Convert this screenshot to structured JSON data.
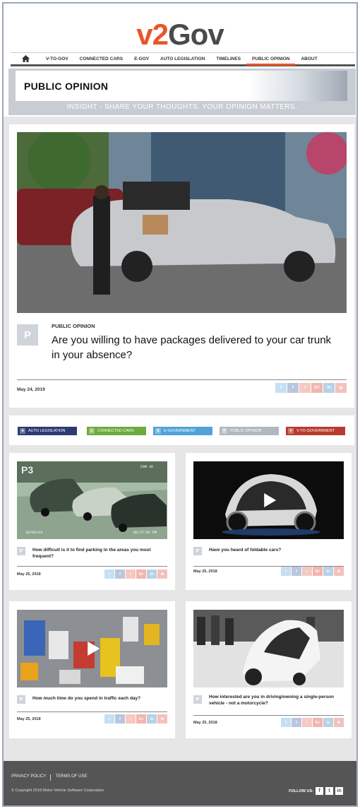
{
  "brand": {
    "logo_v2": "v2",
    "logo_gov": "Gov",
    "accent": "#e8562a"
  },
  "nav": {
    "home_icon": "home-icon",
    "items": [
      "V-TO-GOV",
      "CONNECTED CARS",
      "E-GOV",
      "AUTO LEGISLATION",
      "TIMELINES",
      "PUBLIC OPINION",
      "ABOUT"
    ],
    "active": "PUBLIC OPINION"
  },
  "banner": {
    "title": "PUBLIC OPINION",
    "subtitle": "INSIGHT - SHARE YOUR THOUGHTS. YOUR OPINION MATTERS."
  },
  "featured": {
    "category": "PUBLIC OPINION",
    "title": "Are you willing to have packages delivered to your car trunk in your absence?",
    "date": "May 24, 2019",
    "icon_letter": "P"
  },
  "share_icons": [
    "twitter-icon",
    "facebook-icon",
    "reddit-icon",
    "google-plus-icon",
    "linkedin-icon",
    "email-icon"
  ],
  "share_glyphs": [
    "t",
    "f",
    "r",
    "G+",
    "in",
    "✉"
  ],
  "categories": [
    {
      "letter": "A",
      "label": "AUTO LEGISLATION",
      "color": "#2c3b73"
    },
    {
      "letter": "C",
      "label": "CONNECTED CARS",
      "color": "#6dab3c"
    },
    {
      "letter": "E",
      "label": "E-GOVERNMENT",
      "color": "#4fa3d8"
    },
    {
      "letter": "P",
      "label": "PUBLIC OPINION",
      "color": "#b2b8c0"
    },
    {
      "letter": "V",
      "label": "V-TO-GOVERNMENT",
      "color": "#b73b2e"
    }
  ],
  "cards": [
    {
      "title": "How difficult is it to find parking in the areas you most frequent?",
      "date": "May 25, 2018",
      "icon_letter": "P"
    },
    {
      "title": "Have you heard of foldable cars?",
      "date": "May 25, 2018",
      "icon_letter": "P"
    },
    {
      "title": "How much time do you spend in traffic each day?",
      "date": "May 25, 2018",
      "icon_letter": "P"
    },
    {
      "title": "How interested are you in driving/owning a single-person vehicle - not a motorcycle?",
      "date": "May 25, 2018",
      "icon_letter": "P"
    }
  ],
  "card_images": {
    "cctv_label": "P3",
    "cctv_cam": "CAM 36",
    "cctv_date": "10/03/14",
    "cctv_time": "08:27:02 PM"
  },
  "footer": {
    "privacy": "PRIVACY POLICY",
    "terms": "TERMS OF USE",
    "copyright": "© Copyright 2018 Motor Vehicle Software Corporation",
    "follow": "FOLLOW US:",
    "social_glyphs": [
      "f",
      "t",
      "in"
    ]
  }
}
